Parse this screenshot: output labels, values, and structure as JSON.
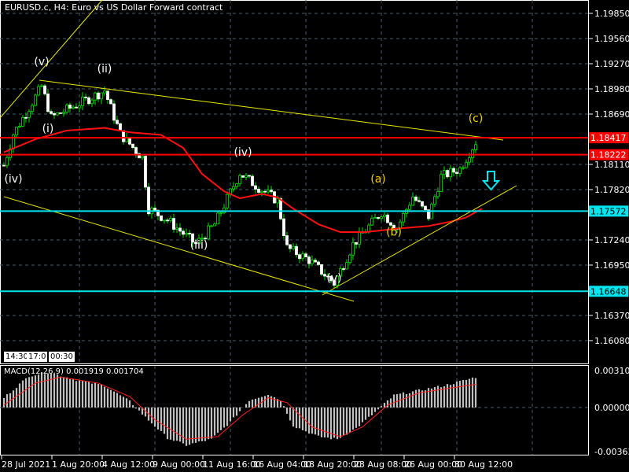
{
  "header": {
    "title": "EURUSD.c, H4:  Euro vs US Dollar Forward contract"
  },
  "price_axis": {
    "ticks": [
      "1.19850",
      "1.19560",
      "1.19270",
      "1.18980",
      "1.18690",
      "1.18110",
      "1.17820",
      "1.17240",
      "1.16950",
      "1.16370",
      "1.16080"
    ],
    "tick_values": [
      1.1985,
      1.1956,
      1.1927,
      1.1898,
      1.1869,
      1.1811,
      1.1782,
      1.1724,
      1.1695,
      1.1637,
      1.1608
    ]
  },
  "levels": [
    {
      "label": "1.18417",
      "value": 1.18417,
      "color": "#ff0000"
    },
    {
      "label": "1.18222",
      "value": 1.18222,
      "color": "#ff0000"
    },
    {
      "label": "1.17572",
      "value": 1.17572,
      "color": "#00e5f0"
    },
    {
      "label": "1.16648",
      "value": 1.16648,
      "color": "#00e5f0"
    }
  ],
  "time_axis": [
    "28 Jul 2021",
    "1 Aug 20:00",
    "4 Aug 12:00",
    "9 Aug 00:00",
    "11 Aug 16:00",
    "16 Aug 04:00",
    "18 Aug 20:00",
    "23 Aug 08:00",
    "26 Aug 00:00",
    "30 Aug 12:00"
  ],
  "time_boxes": [
    "14:30",
    "17:0",
    "00:30"
  ],
  "macd": {
    "label": "MACD(12,26,9) 0.001919 0.001704",
    "ticks": [
      "0.003102",
      "0.000000",
      "-0.003633"
    ],
    "tick_values": [
      0.003102,
      0,
      -0.003633
    ]
  },
  "waves": [
    {
      "text": "(v)",
      "bar": 12,
      "price": 1.1925,
      "color": "#ffffff"
    },
    {
      "text": "(ii)",
      "bar": 32,
      "price": 1.1917,
      "color": "#ffffff"
    },
    {
      "text": "(i)",
      "bar": 14,
      "price": 1.1848,
      "color": "#ffffff"
    },
    {
      "text": "(iv)",
      "bar": 3,
      "price": 1.179,
      "color": "#ffffff"
    },
    {
      "text": "(iv)",
      "bar": 76,
      "price": 1.1821,
      "color": "#ffffff"
    },
    {
      "text": "(iii)",
      "bar": 62,
      "price": 1.1714,
      "color": "#ffffff"
    },
    {
      "text": "(v)",
      "bar": 105,
      "price": 1.1676,
      "color": "#ffffff"
    },
    {
      "text": "(a)",
      "bar": 119,
      "price": 1.179,
      "color": "#f0d000"
    },
    {
      "text": "(b)",
      "bar": 124,
      "price": 1.1729,
      "color": "#f0d000"
    },
    {
      "text": "(c)",
      "bar": 150,
      "price": 1.186,
      "color": "#f0d000"
    }
  ],
  "chart_data": {
    "type": "candlestick",
    "close_waypoints": [
      [
        0,
        1.181
      ],
      [
        3,
        1.1846
      ],
      [
        12,
        1.1901
      ],
      [
        15,
        1.1865
      ],
      [
        25,
        1.1883
      ],
      [
        32,
        1.1896
      ],
      [
        37,
        1.1846
      ],
      [
        44,
        1.1819
      ],
      [
        46,
        1.176
      ],
      [
        52,
        1.1747
      ],
      [
        61,
        1.1719
      ],
      [
        67,
        1.1742
      ],
      [
        75,
        1.1801
      ],
      [
        80,
        1.1787
      ],
      [
        87,
        1.1769
      ],
      [
        90,
        1.1715
      ],
      [
        97,
        1.1701
      ],
      [
        105,
        1.1674
      ],
      [
        111,
        1.1719
      ],
      [
        120,
        1.1756
      ],
      [
        125,
        1.1738
      ],
      [
        130,
        1.1774
      ],
      [
        135,
        1.1751
      ],
      [
        139,
        1.1797
      ],
      [
        145,
        1.1806
      ],
      [
        150,
        1.1837
      ]
    ],
    "ma_waypoints": [
      [
        0,
        1.1825
      ],
      [
        10,
        1.184
      ],
      [
        20,
        1.185
      ],
      [
        32,
        1.1853
      ],
      [
        40,
        1.1848
      ],
      [
        50,
        1.1845
      ],
      [
        57,
        1.183
      ],
      [
        63,
        1.18
      ],
      [
        70,
        1.178
      ],
      [
        75,
        1.1772
      ],
      [
        82,
        1.1777
      ],
      [
        87,
        1.1773
      ],
      [
        92,
        1.176
      ],
      [
        100,
        1.1742
      ],
      [
        107,
        1.1733
      ],
      [
        115,
        1.1733
      ],
      [
        125,
        1.1737
      ],
      [
        135,
        1.174
      ],
      [
        142,
        1.1745
      ],
      [
        147,
        1.175
      ],
      [
        152,
        1.176
      ]
    ],
    "macd_waypoints": [
      [
        0,
        0.0008
      ],
      [
        8,
        0.0026
      ],
      [
        14,
        0.0029
      ],
      [
        24,
        0.0022
      ],
      [
        32,
        0.0018
      ],
      [
        40,
        0.0005
      ],
      [
        45,
        -0.0008
      ],
      [
        52,
        -0.0025
      ],
      [
        58,
        -0.0031
      ],
      [
        66,
        -0.0026
      ],
      [
        72,
        -0.0012
      ],
      [
        78,
        0.0006
      ],
      [
        84,
        0.0011
      ],
      [
        88,
        0.0006
      ],
      [
        92,
        -0.0015
      ],
      [
        100,
        -0.0024
      ],
      [
        106,
        -0.0026
      ],
      [
        112,
        -0.0017
      ],
      [
        118,
        -0.0004
      ],
      [
        124,
        0.001
      ],
      [
        132,
        0.0014
      ],
      [
        140,
        0.0018
      ],
      [
        146,
        0.0022
      ],
      [
        150,
        0.0025
      ]
    ],
    "signal_waypoints": [
      [
        0,
        0.0002
      ],
      [
        10,
        0.002
      ],
      [
        18,
        0.0025
      ],
      [
        30,
        0.002
      ],
      [
        40,
        0.0009
      ],
      [
        48,
        -0.001
      ],
      [
        58,
        -0.0026
      ],
      [
        68,
        -0.0024
      ],
      [
        76,
        -0.0006
      ],
      [
        84,
        0.0008
      ],
      [
        90,
        0.0004
      ],
      [
        98,
        -0.0016
      ],
      [
        107,
        -0.0024
      ],
      [
        114,
        -0.0016
      ],
      [
        122,
        0.0002
      ],
      [
        132,
        0.0012
      ],
      [
        142,
        0.0016
      ],
      [
        150,
        0.0019
      ]
    ]
  }
}
